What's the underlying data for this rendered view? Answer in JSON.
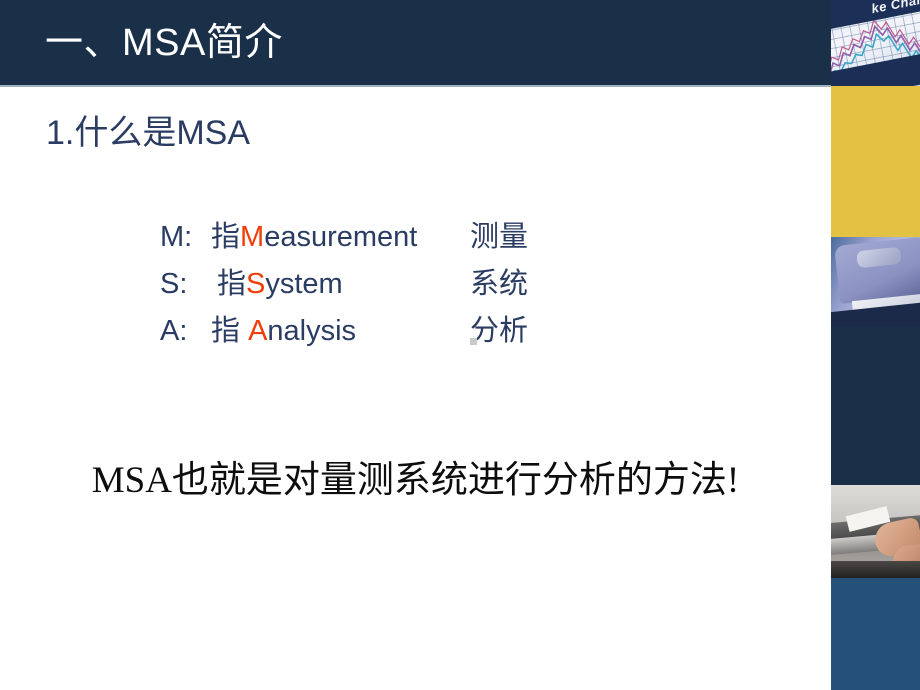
{
  "slide": {
    "title": "一、MSA简介",
    "subheading": "1.什么是MSA",
    "definitions": [
      {
        "abbr": "M:",
        "prefix": "指",
        "initial": "M",
        "rest": "easurement",
        "chinese": "测量"
      },
      {
        "abbr": "S:",
        "prefix": "指",
        "initial": "S",
        "rest": "ystem",
        "chinese": "系统"
      },
      {
        "abbr": "A:",
        "prefix": "指 ",
        "initial": "A",
        "rest": "nalysis",
        "chinese": "分析"
      }
    ],
    "conclusion": "MSA也就是对量测系统进行分析的方法!"
  },
  "sidebar": {
    "panels": [
      {
        "name": "stock-chart-photo",
        "kind": "image",
        "caption": "ke Chart"
      },
      {
        "name": "gold-block",
        "kind": "color",
        "color": "#e3c243"
      },
      {
        "name": "calculator-photo",
        "kind": "image"
      },
      {
        "name": "navy-block",
        "kind": "color",
        "color": "#1a3049"
      },
      {
        "name": "hands-printer-photo",
        "kind": "image"
      },
      {
        "name": "blue-block",
        "kind": "color",
        "color": "#255179"
      }
    ]
  },
  "colors": {
    "header_navy": "#1a3049",
    "body_text_navy": "#2b3c63",
    "accent_red": "#ef3e07",
    "gold": "#e3c243",
    "medium_blue": "#255179",
    "conclusion_black": "#0d0d0d"
  }
}
